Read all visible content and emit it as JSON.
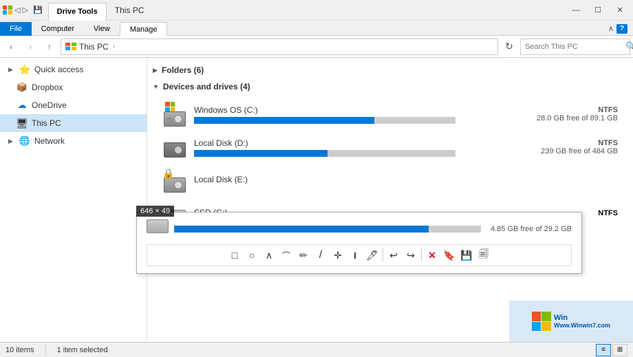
{
  "titlebar": {
    "tabs": [
      {
        "label": "Drive Tools",
        "active": true
      },
      {
        "label": "This PC",
        "is_title": true
      }
    ],
    "title": "This PC",
    "drive_tools_label": "Drive Tools",
    "controls": {
      "minimize": "—",
      "maximize": "☐",
      "close": "✕"
    }
  },
  "ribbon": {
    "tabs": [
      {
        "label": "File",
        "blue": true
      },
      {
        "label": "Computer",
        "active": false
      },
      {
        "label": "View",
        "active": false
      },
      {
        "label": "Manage",
        "active": true
      }
    ]
  },
  "addressbar": {
    "back_disabled": false,
    "forward_disabled": true,
    "up_label": "↑",
    "path_icon": "pc",
    "path_text": "This PC",
    "chevron": "›",
    "search_placeholder": "Search This PC",
    "search_icon": "🔍"
  },
  "sidebar": {
    "items": [
      {
        "label": "Quick access",
        "icon": "⭐",
        "chevron": "▶",
        "active": false,
        "indent": 0
      },
      {
        "label": "Dropbox",
        "icon": "📦",
        "chevron": "",
        "active": false,
        "indent": 8
      },
      {
        "label": "OneDrive",
        "icon": "☁",
        "chevron": "",
        "active": false,
        "indent": 8
      },
      {
        "label": "This PC",
        "icon": "💻",
        "chevron": "",
        "active": true,
        "indent": 8
      },
      {
        "label": "Network",
        "icon": "🌐",
        "chevron": "▶",
        "active": false,
        "indent": 0
      }
    ]
  },
  "content": {
    "folders_section": {
      "title": "Folders (6)",
      "expanded": false,
      "toggle": "▶"
    },
    "drives_section": {
      "title": "Devices and drives (4)",
      "expanded": true,
      "toggle": "▼"
    },
    "drives": [
      {
        "name": "Windows OS (C:)",
        "has_win_icon": true,
        "fs": "NTFS",
        "stats": "28.0 GB free of 89.1 GB",
        "progress": 69,
        "low": false
      },
      {
        "name": "Local Disk (D:)",
        "has_win_icon": false,
        "fs": "NTFS",
        "stats": "239 GB free of 484 GB",
        "progress": 51,
        "low": false
      },
      {
        "name": "Local Disk (E:)",
        "has_win_icon": false,
        "fs": "",
        "stats": "",
        "progress": 0,
        "low": false
      },
      {
        "name": "SSD (G:)",
        "has_win_icon": false,
        "fs": "NTFS",
        "stats": "4.85 GB free of 29.2 GB",
        "progress": 83,
        "low": false
      }
    ]
  },
  "dimension_overlay": {
    "text": "646 × 49"
  },
  "annotation": {
    "drive_stats": "4.85 GB free of 29.2 GB",
    "bar_percent": 83,
    "tools": [
      {
        "icon": "□",
        "name": "rectangle"
      },
      {
        "icon": "○",
        "name": "ellipse"
      },
      {
        "icon": "∧",
        "name": "arrow-up"
      },
      {
        "icon": "⌒",
        "name": "arc"
      },
      {
        "icon": "✏",
        "name": "pencil"
      },
      {
        "icon": "/",
        "name": "line"
      },
      {
        "icon": "✦",
        "name": "crosshair"
      },
      {
        "icon": "T",
        "name": "text"
      },
      {
        "icon": "🖊",
        "name": "marker"
      },
      {
        "icon": "↩",
        "name": "undo"
      },
      {
        "icon": "↪",
        "name": "redo"
      },
      {
        "icon": "✕",
        "name": "close-annotation"
      },
      {
        "icon": "🔖",
        "name": "bookmark"
      },
      {
        "icon": "💾",
        "name": "save-annotation"
      },
      {
        "icon": "🗐",
        "name": "copy"
      }
    ]
  },
  "statusbar": {
    "items_count": "10 items",
    "selected": "1 item selected"
  },
  "watermark": {
    "line1": "Win",
    "line2": "Www.Winwin7.com"
  }
}
